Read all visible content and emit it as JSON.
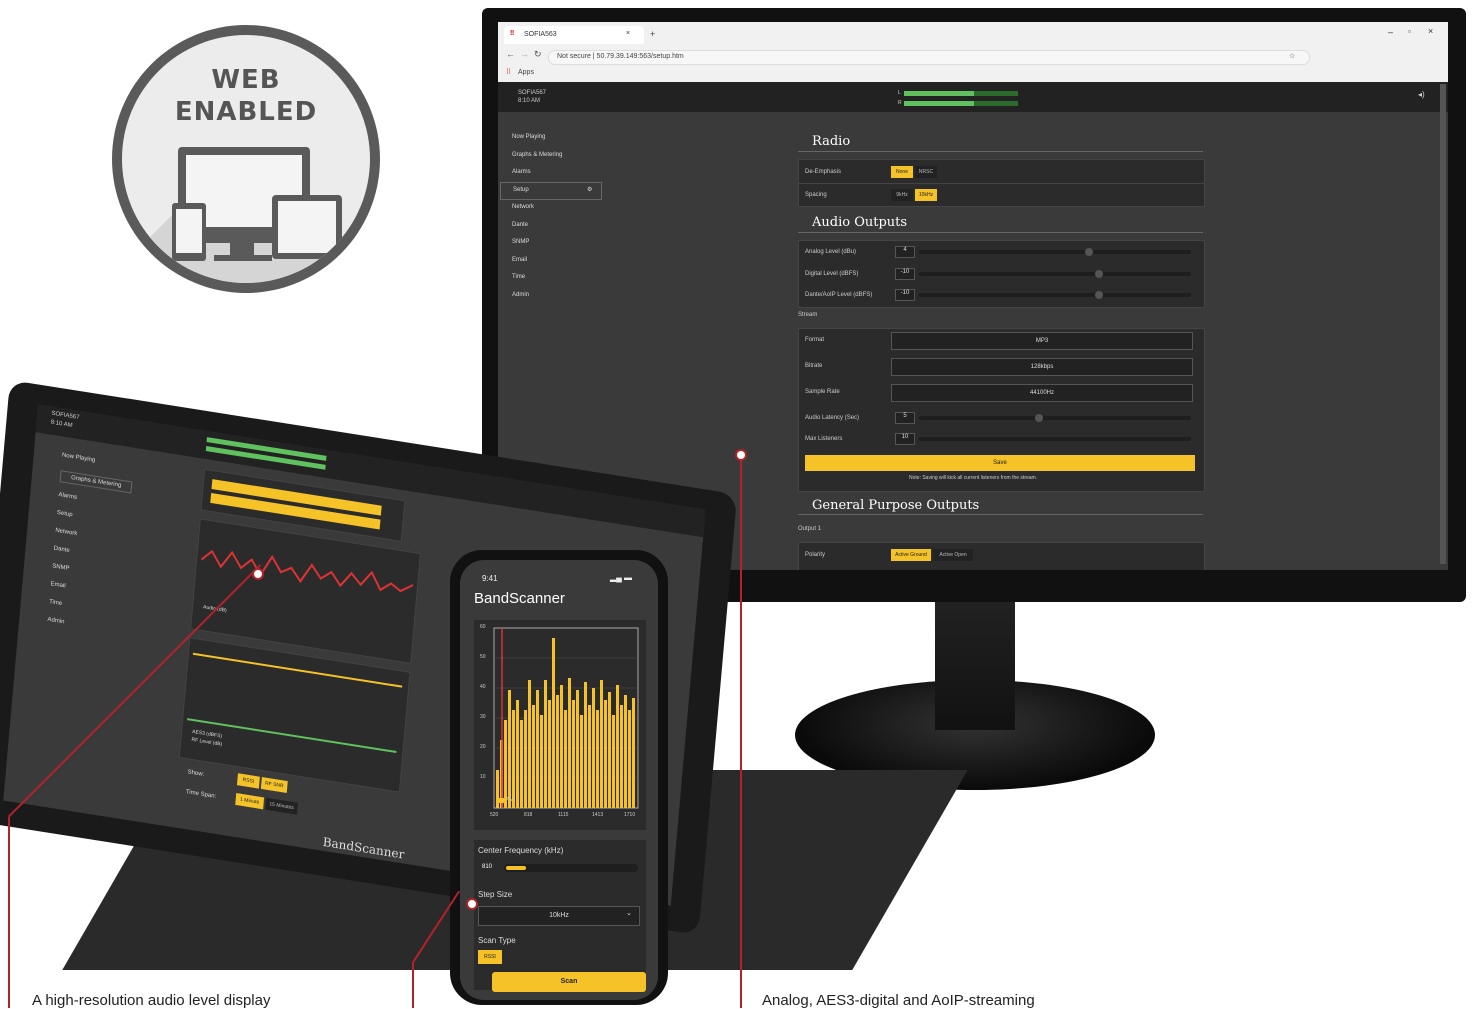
{
  "badge": {
    "line1": "WEB",
    "line2": "ENABLED"
  },
  "browser": {
    "tab_title": "SOFIA563",
    "address": "Not secure | 50.79.39.149:563/setup.htm",
    "apps_label": "Apps"
  },
  "desktop_app": {
    "device_name": "SOFIA567",
    "time": "8:10 AM",
    "meter_labels": [
      "L",
      "R"
    ],
    "sidebar": [
      "Now Playing",
      "Graphs & Metering",
      "Alarms",
      "Setup",
      "Network",
      "Dante",
      "SNMP",
      "Email",
      "Time",
      "Admin"
    ],
    "radio": {
      "title": "Radio",
      "de_emphasis_label": "De-Emphasis",
      "de_emphasis_options": [
        "None",
        "NRSC"
      ],
      "spacing_label": "Spacing",
      "spacing_options": [
        "9kHz",
        "10kHz"
      ]
    },
    "audio_outputs": {
      "title": "Audio Outputs",
      "analog_label": "Analog Level (dBu)",
      "analog_value": "4",
      "digital_label": "Digital Level (dBFS)",
      "digital_value": "-10",
      "dante_label": "Dante/AoIP Level (dBFS)",
      "dante_value": "-10"
    },
    "stream": {
      "heading": "Stream",
      "format_label": "Format",
      "format_value": "MP3",
      "bitrate_label": "Bitrate",
      "bitrate_value": "128kbps",
      "sample_rate_label": "Sample Rate",
      "sample_rate_value": "44100Hz",
      "latency_label": "Audio Latency (Sec)",
      "latency_value": "5",
      "max_listeners_label": "Max Listeners",
      "max_listeners_value": "10",
      "save_label": "Save",
      "note": "Note: Saving will kick all current listeners from the stream."
    },
    "gpo": {
      "title": "General Purpose Outputs",
      "output_heading": "Output 1",
      "polarity_label": "Polarity",
      "polarity_options": [
        "Active Ground",
        "Active Open"
      ]
    }
  },
  "tablet_app": {
    "device_name": "SOFIA567",
    "time": "8:10 AM",
    "sidebar": [
      "Now Playing",
      "Graphs & Metering",
      "Alarms",
      "Setup",
      "Network",
      "Dante",
      "SNMP",
      "Email",
      "Time",
      "Admin"
    ],
    "legend_audio": "Audio (dB)",
    "legend_a": "AES3 (dBFS)",
    "legend_b": "RF Level (dB)",
    "show_label": "Show:",
    "show_options": [
      "RSSI",
      "RF SNR"
    ],
    "span_label": "Time Span:",
    "span_options": [
      "1 Minute",
      "15 Minutes"
    ],
    "footer": "BandScanner"
  },
  "phone_app": {
    "time": "9:41",
    "title": "BandScanner",
    "y_ticks": [
      "60",
      "50",
      "40",
      "30",
      "20",
      "10"
    ],
    "x_ticks": [
      "520",
      "818",
      "1115",
      "1413",
      "1710"
    ],
    "legend": "AM",
    "center_freq_label": "Center Frequency (kHz)",
    "center_freq_value": "810",
    "center_freq_level": 0.15,
    "step_size_label": "Step Size",
    "step_size_value": "10kHz",
    "scan_type_label": "Scan Type",
    "scan_type_value": "RSSI",
    "scan_button": "Scan"
  },
  "captions": {
    "left": "A high-resolution audio level display",
    "right": "Analog, AES3-digital and AoIP-streaming"
  },
  "colors": {
    "accent": "#f5c228",
    "callout": "#b3222a",
    "panel": "#3a3a3a"
  }
}
